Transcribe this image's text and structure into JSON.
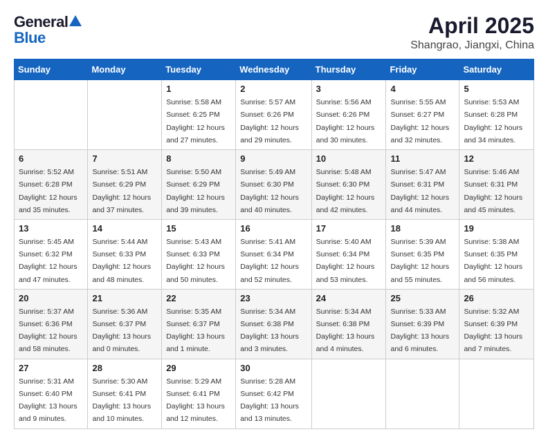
{
  "logo": {
    "general": "General",
    "blue": "Blue"
  },
  "title": "April 2025",
  "location": "Shangrao, Jiangxi, China",
  "days_of_week": [
    "Sunday",
    "Monday",
    "Tuesday",
    "Wednesday",
    "Thursday",
    "Friday",
    "Saturday"
  ],
  "weeks": [
    [
      {
        "day": "",
        "info": ""
      },
      {
        "day": "",
        "info": ""
      },
      {
        "day": "1",
        "info": "Sunrise: 5:58 AM\nSunset: 6:25 PM\nDaylight: 12 hours and 27 minutes."
      },
      {
        "day": "2",
        "info": "Sunrise: 5:57 AM\nSunset: 6:26 PM\nDaylight: 12 hours and 29 minutes."
      },
      {
        "day": "3",
        "info": "Sunrise: 5:56 AM\nSunset: 6:26 PM\nDaylight: 12 hours and 30 minutes."
      },
      {
        "day": "4",
        "info": "Sunrise: 5:55 AM\nSunset: 6:27 PM\nDaylight: 12 hours and 32 minutes."
      },
      {
        "day": "5",
        "info": "Sunrise: 5:53 AM\nSunset: 6:28 PM\nDaylight: 12 hours and 34 minutes."
      }
    ],
    [
      {
        "day": "6",
        "info": "Sunrise: 5:52 AM\nSunset: 6:28 PM\nDaylight: 12 hours and 35 minutes."
      },
      {
        "day": "7",
        "info": "Sunrise: 5:51 AM\nSunset: 6:29 PM\nDaylight: 12 hours and 37 minutes."
      },
      {
        "day": "8",
        "info": "Sunrise: 5:50 AM\nSunset: 6:29 PM\nDaylight: 12 hours and 39 minutes."
      },
      {
        "day": "9",
        "info": "Sunrise: 5:49 AM\nSunset: 6:30 PM\nDaylight: 12 hours and 40 minutes."
      },
      {
        "day": "10",
        "info": "Sunrise: 5:48 AM\nSunset: 6:30 PM\nDaylight: 12 hours and 42 minutes."
      },
      {
        "day": "11",
        "info": "Sunrise: 5:47 AM\nSunset: 6:31 PM\nDaylight: 12 hours and 44 minutes."
      },
      {
        "day": "12",
        "info": "Sunrise: 5:46 AM\nSunset: 6:31 PM\nDaylight: 12 hours and 45 minutes."
      }
    ],
    [
      {
        "day": "13",
        "info": "Sunrise: 5:45 AM\nSunset: 6:32 PM\nDaylight: 12 hours and 47 minutes."
      },
      {
        "day": "14",
        "info": "Sunrise: 5:44 AM\nSunset: 6:33 PM\nDaylight: 12 hours and 48 minutes."
      },
      {
        "day": "15",
        "info": "Sunrise: 5:43 AM\nSunset: 6:33 PM\nDaylight: 12 hours and 50 minutes."
      },
      {
        "day": "16",
        "info": "Sunrise: 5:41 AM\nSunset: 6:34 PM\nDaylight: 12 hours and 52 minutes."
      },
      {
        "day": "17",
        "info": "Sunrise: 5:40 AM\nSunset: 6:34 PM\nDaylight: 12 hours and 53 minutes."
      },
      {
        "day": "18",
        "info": "Sunrise: 5:39 AM\nSunset: 6:35 PM\nDaylight: 12 hours and 55 minutes."
      },
      {
        "day": "19",
        "info": "Sunrise: 5:38 AM\nSunset: 6:35 PM\nDaylight: 12 hours and 56 minutes."
      }
    ],
    [
      {
        "day": "20",
        "info": "Sunrise: 5:37 AM\nSunset: 6:36 PM\nDaylight: 12 hours and 58 minutes."
      },
      {
        "day": "21",
        "info": "Sunrise: 5:36 AM\nSunset: 6:37 PM\nDaylight: 13 hours and 0 minutes."
      },
      {
        "day": "22",
        "info": "Sunrise: 5:35 AM\nSunset: 6:37 PM\nDaylight: 13 hours and 1 minute."
      },
      {
        "day": "23",
        "info": "Sunrise: 5:34 AM\nSunset: 6:38 PM\nDaylight: 13 hours and 3 minutes."
      },
      {
        "day": "24",
        "info": "Sunrise: 5:34 AM\nSunset: 6:38 PM\nDaylight: 13 hours and 4 minutes."
      },
      {
        "day": "25",
        "info": "Sunrise: 5:33 AM\nSunset: 6:39 PM\nDaylight: 13 hours and 6 minutes."
      },
      {
        "day": "26",
        "info": "Sunrise: 5:32 AM\nSunset: 6:39 PM\nDaylight: 13 hours and 7 minutes."
      }
    ],
    [
      {
        "day": "27",
        "info": "Sunrise: 5:31 AM\nSunset: 6:40 PM\nDaylight: 13 hours and 9 minutes."
      },
      {
        "day": "28",
        "info": "Sunrise: 5:30 AM\nSunset: 6:41 PM\nDaylight: 13 hours and 10 minutes."
      },
      {
        "day": "29",
        "info": "Sunrise: 5:29 AM\nSunset: 6:41 PM\nDaylight: 13 hours and 12 minutes."
      },
      {
        "day": "30",
        "info": "Sunrise: 5:28 AM\nSunset: 6:42 PM\nDaylight: 13 hours and 13 minutes."
      },
      {
        "day": "",
        "info": ""
      },
      {
        "day": "",
        "info": ""
      },
      {
        "day": "",
        "info": ""
      }
    ]
  ]
}
